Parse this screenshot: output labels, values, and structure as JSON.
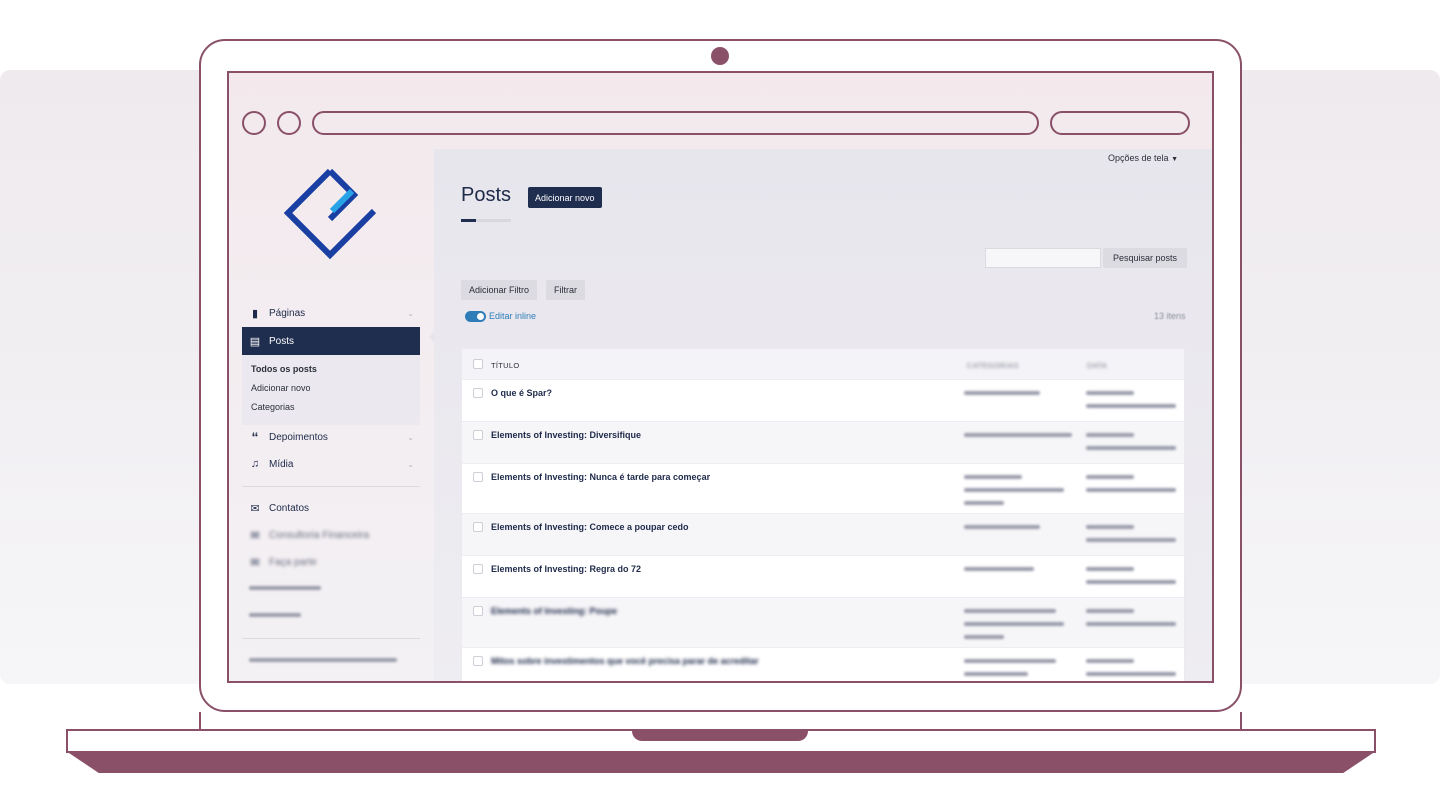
{
  "screen_options": "Opções de tela",
  "screen_options_caret": "▼",
  "page_title": "Posts",
  "add_new_button": "Adicionar novo",
  "search_button": "Pesquisar posts",
  "add_filter_button": "Adicionar Filtro",
  "filter_button": "Filtrar",
  "inline_edit_label": "Editar inline",
  "items_count": "13 itens",
  "sidebar": {
    "items": [
      {
        "label": "Páginas",
        "icon": "pages-icon"
      },
      {
        "label": "Posts",
        "icon": "posts-icon"
      },
      {
        "label": "Depoimentos",
        "icon": "quote-icon"
      },
      {
        "label": "Mídia",
        "icon": "media-icon"
      },
      {
        "label": "Contatos",
        "icon": "mail-icon"
      },
      {
        "label": "Consultoria Financeira",
        "icon": "mail-icon"
      },
      {
        "label": "Faça parte",
        "icon": "mail-icon"
      }
    ],
    "submenu": [
      "Todos os posts",
      "Adicionar novo",
      "Categorias"
    ]
  },
  "table": {
    "headers": {
      "title": "TÍTULO",
      "categories": "CATEGORIAS",
      "date": "DATA"
    },
    "rows": [
      {
        "title": "O que é Spar?"
      },
      {
        "title": "Elements of Investing: Diversifique"
      },
      {
        "title": "Elements of Investing: Nunca é tarde para começar"
      },
      {
        "title": "Elements of Investing: Comece a poupar cedo"
      },
      {
        "title": "Elements of Investing: Regra do 72"
      },
      {
        "title": "Elements of Investing: Poupe"
      },
      {
        "title": "Mitos sobre investimentos que você precisa parar de acreditar"
      }
    ]
  },
  "colors": {
    "accent_dark": "#1f2d4f",
    "toggle_blue": "#2f7db8",
    "laptop_outline": "#8a5068",
    "logo_blue": "#1a3fa3",
    "logo_light_blue": "#27a3e6"
  }
}
